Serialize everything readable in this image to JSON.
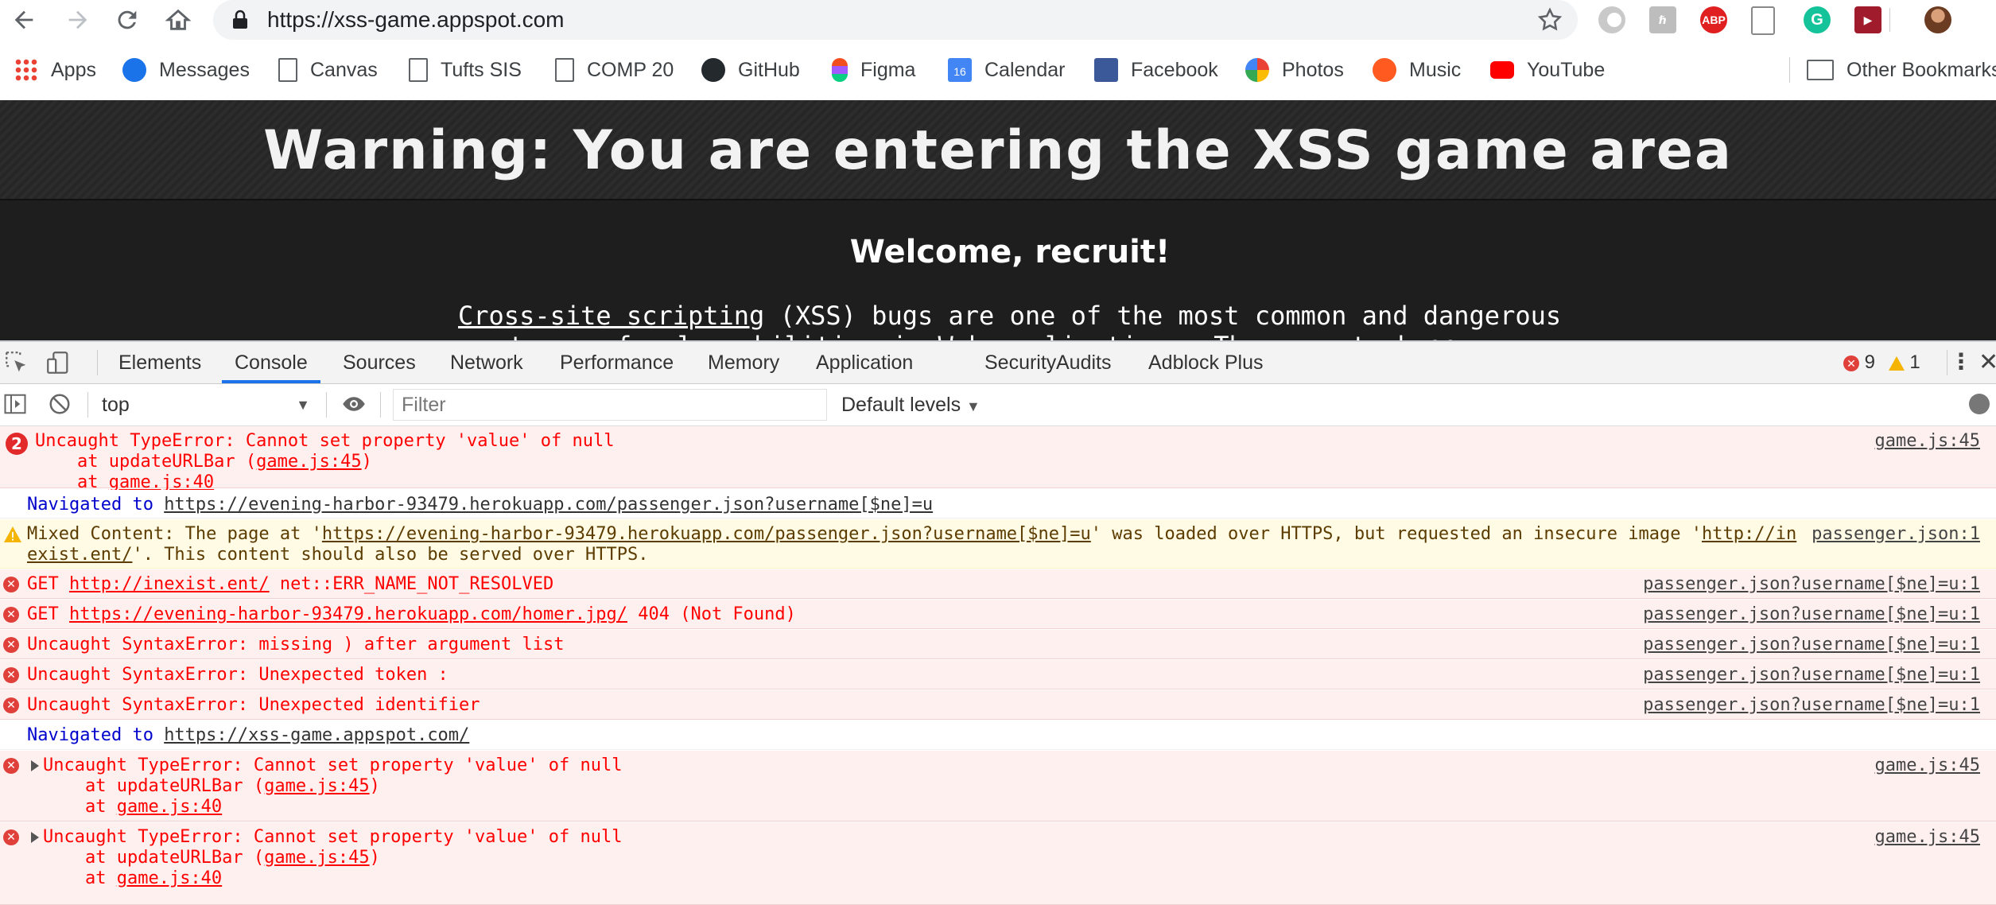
{
  "browser": {
    "url": "https://xss-game.appspot.com",
    "extensions": [
      {
        "icon": "grey-circle-extension-icon"
      },
      {
        "icon": "h-extension-icon"
      },
      {
        "icon": "abp-extension-icon",
        "label": "ABP"
      },
      {
        "icon": "document-extension-icon"
      },
      {
        "icon": "grammarly-extension-icon",
        "label": "G"
      },
      {
        "icon": "red-play-extension-icon"
      },
      {
        "icon": "profile-avatar-icon"
      }
    ]
  },
  "bookmarks": [
    {
      "label": "Apps",
      "icon": "apps-grid-icon"
    },
    {
      "label": "Messages",
      "icon": "messages-icon"
    },
    {
      "label": "Canvas",
      "icon": "page-icon"
    },
    {
      "label": "Tufts SIS",
      "icon": "page-icon"
    },
    {
      "label": "COMP 20",
      "icon": "page-icon"
    },
    {
      "label": "GitHub",
      "icon": "github-icon"
    },
    {
      "label": "Figma",
      "icon": "figma-icon"
    },
    {
      "label": "Calendar",
      "icon": "calendar-icon",
      "badge": "16"
    },
    {
      "label": "Facebook",
      "icon": "facebook-icon"
    },
    {
      "label": "Photos",
      "icon": "photos-icon"
    },
    {
      "label": "Music",
      "icon": "music-icon"
    },
    {
      "label": "YouTube",
      "icon": "youtube-icon"
    },
    {
      "label": "Other Bookmarks",
      "icon": "folder-icon"
    }
  ],
  "page": {
    "banner_title": "Warning: You are entering the XSS game area",
    "welcome": "Welcome, recruit!",
    "intro_link": "Cross-site scripting",
    "intro_rest": " (XSS) bugs are one of the most common and dangerous",
    "intro_line2": "types of vulnerabilities in Web applications. These nasty buggers"
  },
  "devtools": {
    "tabs": [
      "Elements",
      "Console",
      "Sources",
      "Network",
      "Performance",
      "Memory",
      "Application",
      "Security",
      "Audits",
      "Adblock Plus"
    ],
    "active_tab": "Console",
    "error_count": "9",
    "warning_count": "1",
    "context": "top",
    "filter_placeholder": "Filter",
    "levels": "Default levels"
  },
  "console": {
    "m1": {
      "count": "2",
      "l1": "Uncaught TypeError: Cannot set property 'value' of null",
      "l2a": "    at updateURLBar (",
      "l2link": "game.js:45",
      "l2b": ")",
      "l3a": "    at ",
      "l3link": "game.js:40",
      "src": "game.js:45"
    },
    "m2": {
      "prefix": "Navigated to ",
      "link": "https://evening-harbor-93479.herokuapp.com/passenger.json?username[$ne]=u"
    },
    "m3": {
      "a": "Mixed Content: The page at '",
      "link1": "https://evening-harbor-93479.herokuapp.com/passenger.json?username[$ne]=u",
      "b": "' was loaded over HTTPS, but requested an insecure image '",
      "link2a": "http://in",
      "link2b": "exist.ent/",
      "c": "'. This content should also be served over HTTPS.",
      "src": "passenger.json:1"
    },
    "m4": {
      "a": "GET ",
      "link": "http://inexist.ent/",
      "b": " net::ERR_NAME_NOT_RESOLVED",
      "src": "passenger.json?username[$ne]=u:1"
    },
    "m5": {
      "a": "GET ",
      "link": "https://evening-harbor-93479.herokuapp.com/homer.jpg/",
      "b": " 404 (Not Found)",
      "src": "passenger.json?username[$ne]=u:1"
    },
    "m6": {
      "text": "Uncaught SyntaxError: missing ) after argument list",
      "src": "passenger.json?username[$ne]=u:1"
    },
    "m7": {
      "text": "Uncaught SyntaxError: Unexpected token :",
      "src": "passenger.json?username[$ne]=u:1"
    },
    "m8": {
      "text": "Uncaught SyntaxError: Unexpected identifier",
      "src": "passenger.json?username[$ne]=u:1"
    },
    "m9": {
      "prefix": "Navigated to ",
      "link": "https://xss-game.appspot.com/"
    },
    "m10": {
      "l1": "Uncaught TypeError: Cannot set property 'value' of null",
      "l2a": "    at updateURLBar (",
      "l2link": "game.js:45",
      "l2b": ")",
      "l3a": "    at ",
      "l3link": "game.js:40",
      "src": "game.js:45"
    },
    "m11": {
      "l1": "Uncaught TypeError: Cannot set property 'value' of null",
      "l2a": "    at updateURLBar (",
      "l2link": "game.js:45",
      "l2b": ")",
      "l3a": "    at ",
      "l3link": "game.js:40",
      "src": "game.js:45"
    }
  }
}
